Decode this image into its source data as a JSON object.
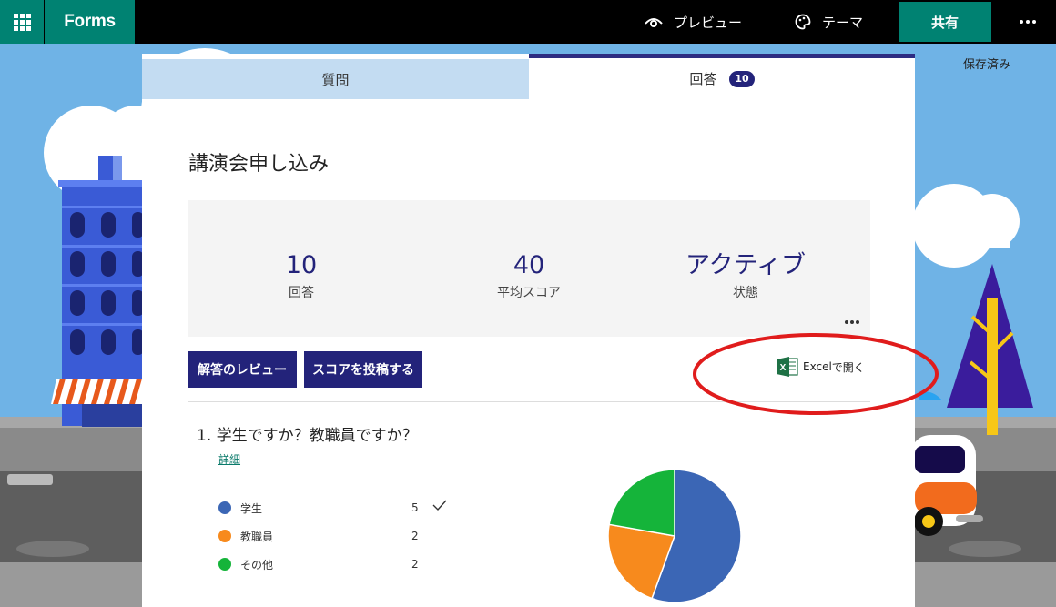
{
  "app": {
    "name": "Forms"
  },
  "topbar": {
    "preview_label": "プレビュー",
    "theme_label": "テーマ",
    "share_label": "共有"
  },
  "status": {
    "saved": "保存済み"
  },
  "tabs": {
    "questions": "質問",
    "responses": "回答",
    "responses_count": "10"
  },
  "form": {
    "title": "講演会申し込み"
  },
  "summary": {
    "responses_value": "10",
    "responses_label": "回答",
    "avg_score_value": "40",
    "avg_score_label": "平均スコア",
    "status_value": "アクティブ",
    "status_label": "状態"
  },
  "actions": {
    "review": "解答のレビュー",
    "post_scores": "スコアを投稿する",
    "open_excel_brand": "Excel",
    "open_excel_suffix": " で開く"
  },
  "question1": {
    "number": "1.",
    "title": "学生ですか？教職員ですか？",
    "details_link": "詳細",
    "options": [
      {
        "label": "学生",
        "count": "5",
        "color": "#3b66b5",
        "correct": true
      },
      {
        "label": "教職員",
        "count": "2",
        "color": "#f78a1d",
        "correct": false
      },
      {
        "label": "その他",
        "count": "2",
        "color": "#15b43a",
        "correct": false
      }
    ]
  },
  "colors": {
    "accent_dark": "#23237a",
    "brand_green": "#008272",
    "annotation_red": "#e01c1c"
  }
}
